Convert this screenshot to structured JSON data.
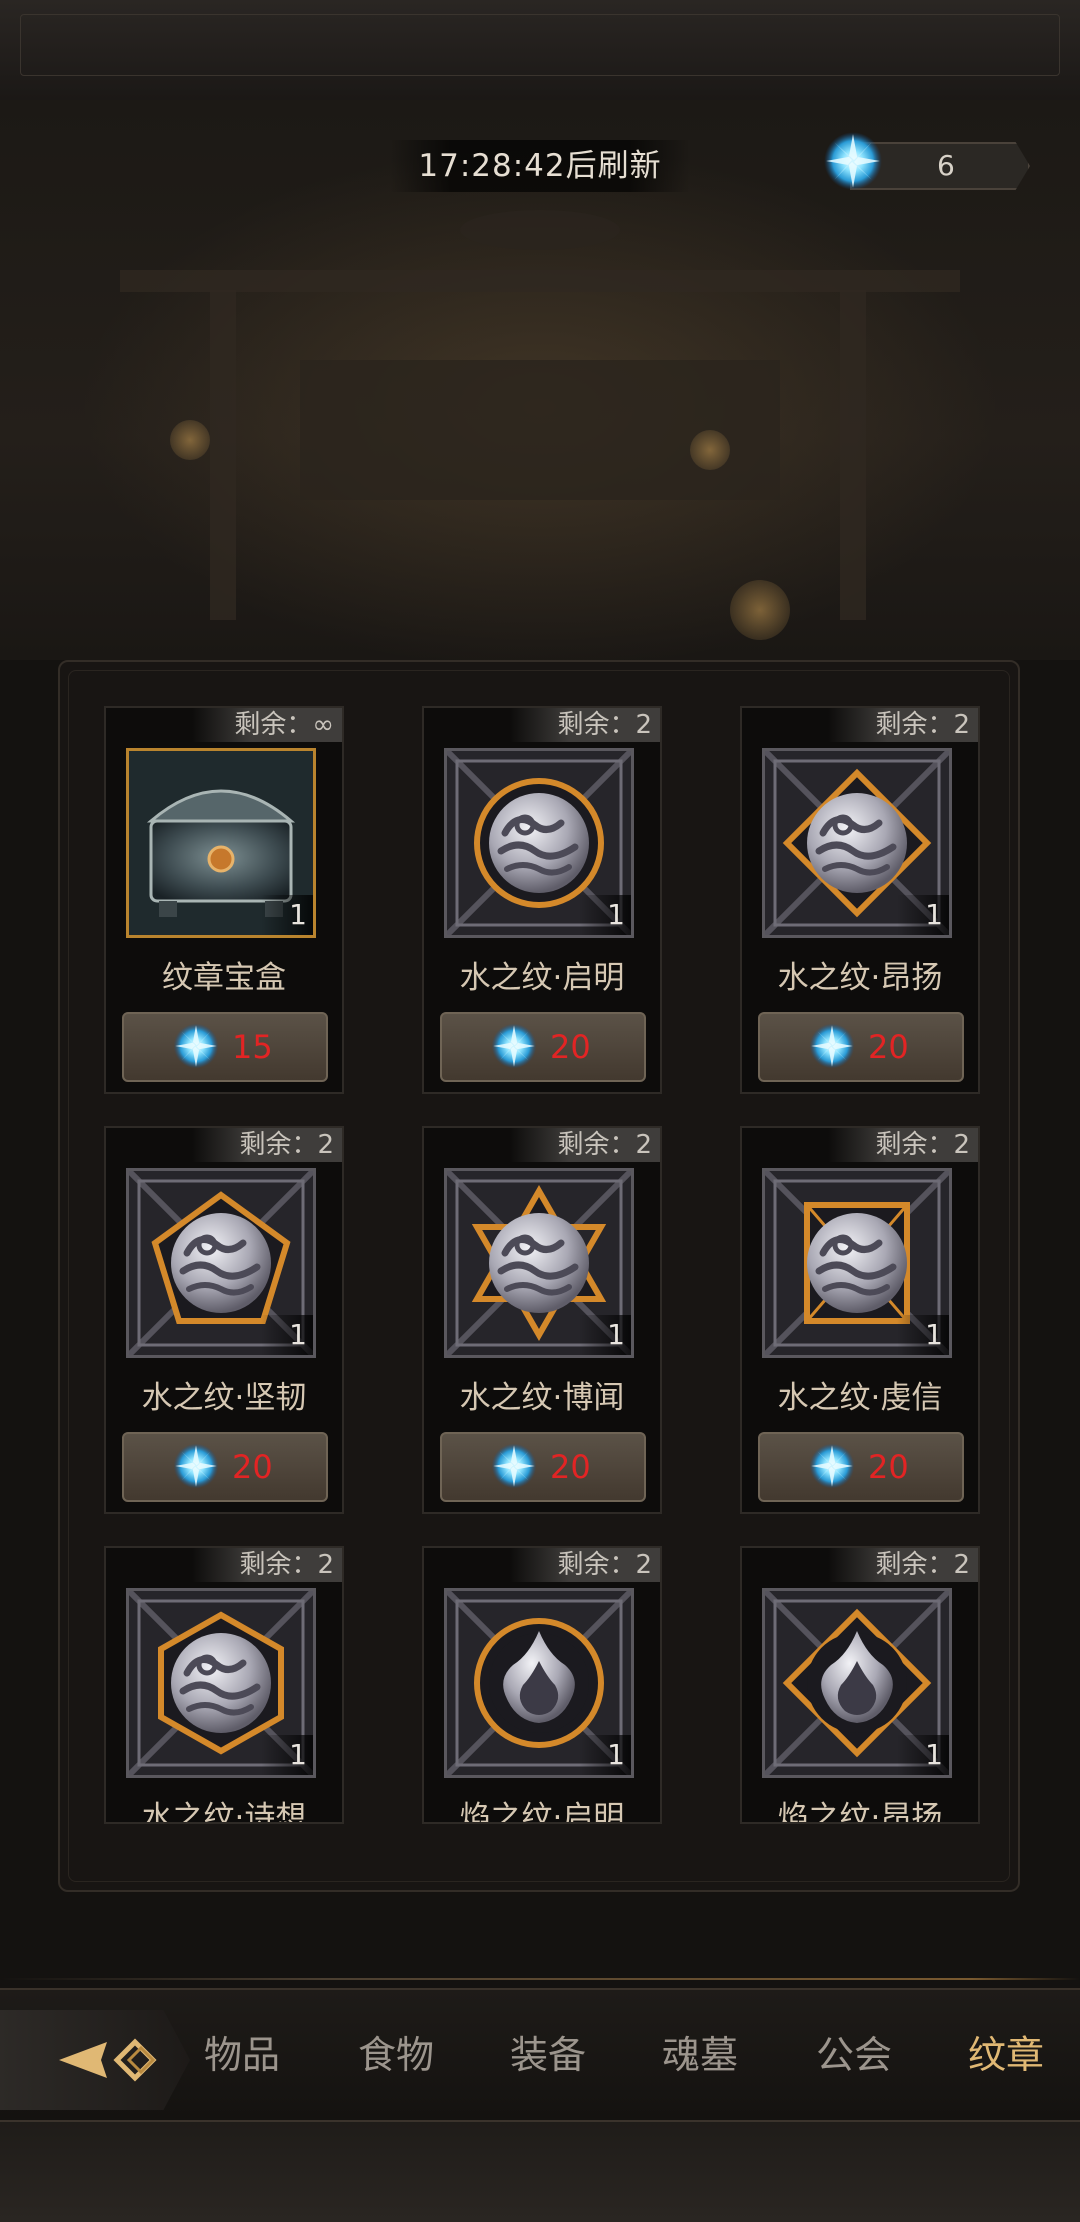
{
  "header": {
    "refresh_timer": "17:28:42后刷新",
    "currency_value": "6",
    "currency_icon": "blue-crystal-icon"
  },
  "shop_items": [
    {
      "remaining": "剩余：∞",
      "name": "纹章宝盒",
      "qty": "1",
      "price": "15",
      "icon": "chest-icon"
    },
    {
      "remaining": "剩余：2",
      "name": "水之纹·启明",
      "qty": "1",
      "price": "20",
      "icon": "water-sigil-circle-icon"
    },
    {
      "remaining": "剩余：2",
      "name": "水之纹·昂扬",
      "qty": "1",
      "price": "20",
      "icon": "water-sigil-diamond-icon"
    },
    {
      "remaining": "剩余：2",
      "name": "水之纹·坚韧",
      "qty": "1",
      "price": "20",
      "icon": "water-sigil-pentagon-icon"
    },
    {
      "remaining": "剩余：2",
      "name": "水之纹·博闻",
      "qty": "1",
      "price": "20",
      "icon": "water-sigil-hexagram-icon"
    },
    {
      "remaining": "剩余：2",
      "name": "水之纹·虔信",
      "qty": "1",
      "price": "20",
      "icon": "water-sigil-square-icon"
    },
    {
      "remaining": "剩余：2",
      "name": "水之纹·诗想",
      "qty": "1",
      "icon": "water-sigil-hexagon-icon"
    },
    {
      "remaining": "剩余：2",
      "name": "焰之纹·启明",
      "qty": "1",
      "icon": "flame-sigil-circle-icon"
    },
    {
      "remaining": "剩余：2",
      "name": "焰之纹·昂扬",
      "qty": "1",
      "icon": "flame-sigil-diamond-icon"
    }
  ],
  "tabs": [
    {
      "label": "物品"
    },
    {
      "label": "食物"
    },
    {
      "label": "装备"
    },
    {
      "label": "魂墓"
    },
    {
      "label": "公会"
    },
    {
      "label": "纹章"
    }
  ],
  "active_tab": "纹章",
  "colors": {
    "price_text": "#e22424",
    "active_tab": "#e0b874",
    "inactive_tab": "#9c958d",
    "frame_gold": "#c9892a"
  }
}
